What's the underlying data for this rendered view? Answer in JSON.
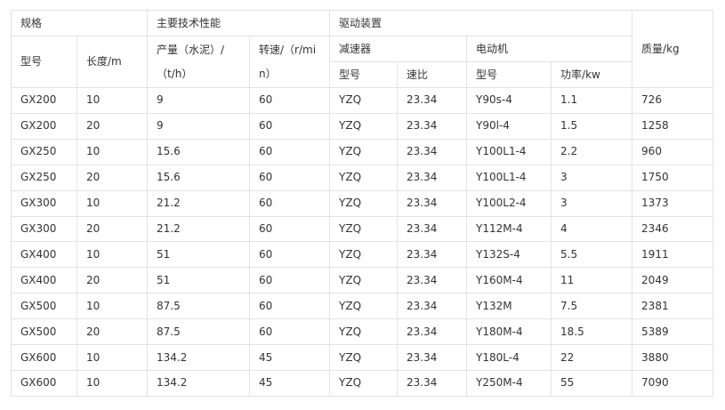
{
  "header": {
    "spec_group": "规格",
    "perf_group": "主要技术性能",
    "drive_group": "驱动装置",
    "model": "型号",
    "length": "长度/m",
    "capacity": "产量（水泥）/（t/h）",
    "speed": "转速/（r/min）",
    "reducer_group": "减速器",
    "motor_group": "电动机",
    "mass": "质量/kg",
    "reducer_model": "型号",
    "reducer_ratio": "速比",
    "motor_model": "型号",
    "motor_power": "功率/kw"
  },
  "rows": [
    [
      "GX200",
      "10",
      "9",
      "60",
      "YZQ",
      "23.34",
      "Y90s-4",
      "1.1",
      "726"
    ],
    [
      "GX200",
      "20",
      "9",
      "60",
      "YZQ",
      "23.34",
      "Y90l-4",
      "1.5",
      "1258"
    ],
    [
      "GX250",
      "10",
      "15.6",
      "60",
      "YZQ",
      "23.34",
      "Y100L1-4",
      "2.2",
      "960"
    ],
    [
      "GX250",
      "20",
      "15.6",
      "60",
      "YZQ",
      "23.34",
      "Y100L1-4",
      "3",
      "1750"
    ],
    [
      "GX300",
      "10",
      "21.2",
      "60",
      "YZQ",
      "23.34",
      "Y100L2-4",
      "3",
      "1373"
    ],
    [
      "GX300",
      "20",
      "21.2",
      "60",
      "YZQ",
      "23.34",
      "Y112M-4",
      "4",
      "2346"
    ],
    [
      "GX400",
      "10",
      "51",
      "60",
      "YZQ",
      "23.34",
      "Y132S-4",
      "5.5",
      "1911"
    ],
    [
      "GX400",
      "20",
      "51",
      "60",
      "YZQ",
      "23.34",
      "Y160M-4",
      "11",
      "2049"
    ],
    [
      "GX500",
      "10",
      "87.5",
      "60",
      "YZQ",
      "23.34",
      "Y132M",
      "7.5",
      "2381"
    ],
    [
      "GX500",
      "20",
      "87.5",
      "60",
      "YZQ",
      "23.34",
      "Y180M-4",
      "18.5",
      "5389"
    ],
    [
      "GX600",
      "10",
      "134.2",
      "45",
      "YZQ",
      "23.34",
      "Y180L-4",
      "22",
      "3880"
    ],
    [
      "GX600",
      "10",
      "134.2",
      "45",
      "YZQ",
      "23.34",
      "Y250M-4",
      "55",
      "7090"
    ]
  ]
}
